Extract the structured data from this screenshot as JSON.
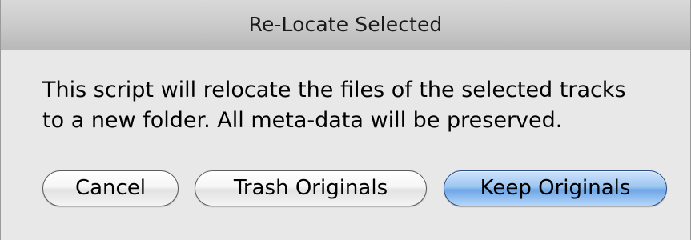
{
  "dialog": {
    "title": "Re-Locate Selected",
    "message_line1": "This script will relocate the files of the selected tracks",
    "message_line2": "to a new folder. All meta-data will be preserved.",
    "buttons": {
      "cancel": "Cancel",
      "trash": "Trash Originals",
      "keep": "Keep Originals"
    }
  },
  "colors": {
    "default_button": "#8fbdee",
    "background": "#e8e8e8"
  }
}
